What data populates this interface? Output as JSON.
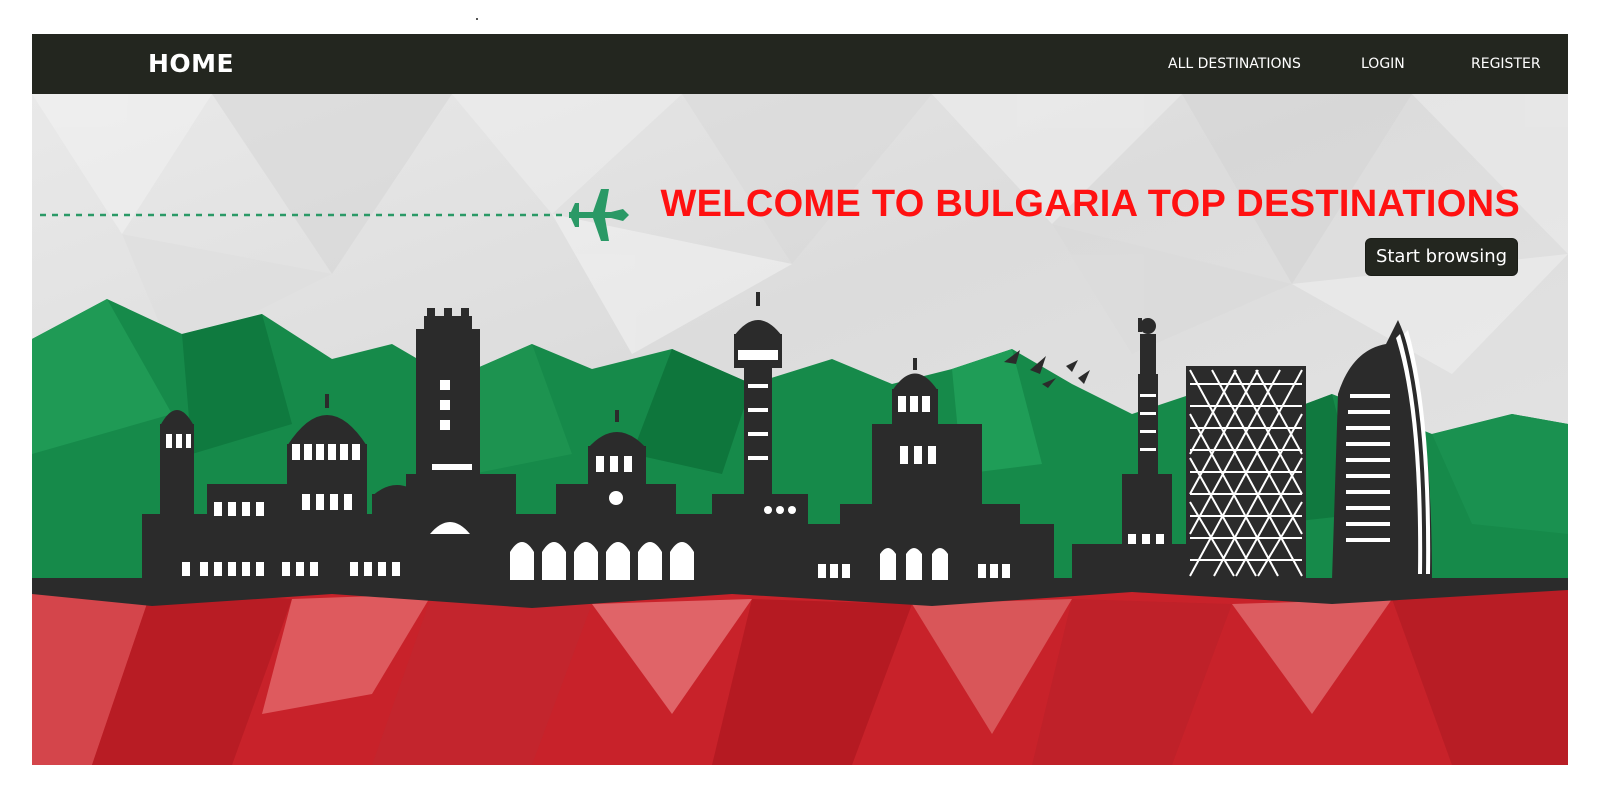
{
  "navbar": {
    "brand": "HOME",
    "links": [
      {
        "label": "ALL DESTINATIONS"
      },
      {
        "label": "LOGIN"
      },
      {
        "label": "REGISTER"
      }
    ]
  },
  "hero": {
    "headline": "WELCOME TO BULGARIA TOP DESTINATIONS",
    "cta_label": "Start browsing",
    "airplane_icon": "airplane-icon",
    "colors": {
      "headline": "#ff1111",
      "navbar": "#23261f",
      "flag_white": "#e6e6e6",
      "flag_green": "#168a4a",
      "flag_red": "#c8222a",
      "skyline": "#2b2b2b",
      "flight_path": "#2a9966"
    }
  }
}
